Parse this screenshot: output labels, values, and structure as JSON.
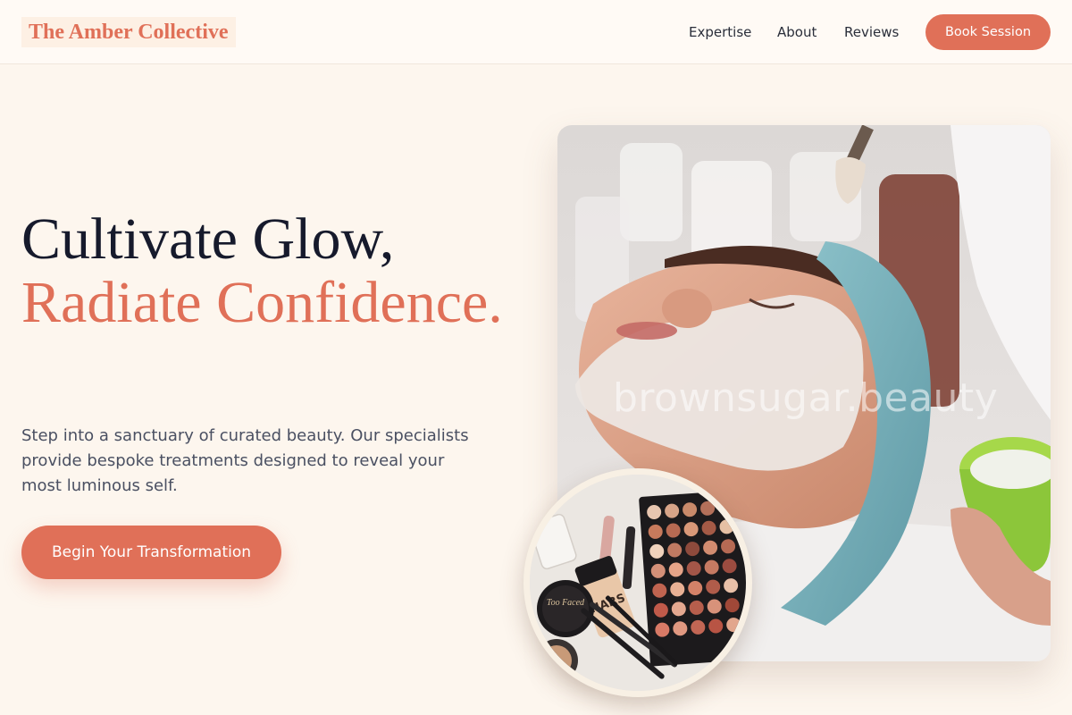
{
  "header": {
    "logo_text": "The Amber Collective",
    "nav": {
      "expertise": "Expertise",
      "about": "About",
      "reviews": "Reviews"
    },
    "book_button": "Book Session"
  },
  "hero": {
    "title_line1": "Cultivate Glow,",
    "title_line2": "Radiate Confidence.",
    "description": "Step into a sanctuary of curated beauty. Our specialists provide bespoke treatments designed to reveal your most luminous self.",
    "cta_button": "Begin Your Transformation"
  },
  "images": {
    "main_photo_watermark": "brownsugar.beauty",
    "main_photo_icon": "facial-mask-photo",
    "secondary_photo_icon": "makeup-palette-photo",
    "palette_brand": "Too Faced",
    "pencil_brand": "NARS"
  },
  "colors": {
    "accent": "#e07058",
    "heading": "#161a2c",
    "body_text": "#4a5062",
    "background": "#fdf6ee"
  }
}
